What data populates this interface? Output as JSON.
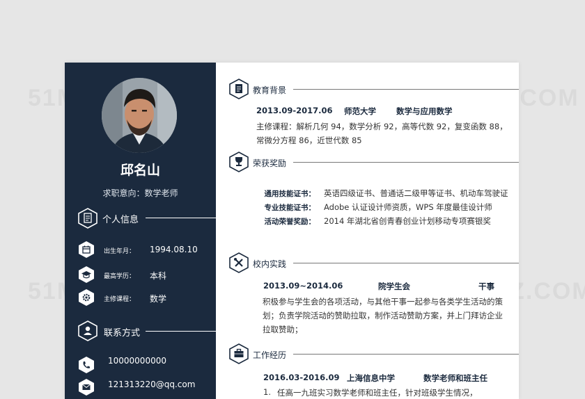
{
  "watermark": "51MZ.COM",
  "sidebar": {
    "name": "邱名山",
    "intent": "求职意向：数学老师",
    "personal": {
      "title": "个人信息",
      "items": [
        {
          "icon": "calendar-icon",
          "label": "出生年月：",
          "value": "1994.08.10"
        },
        {
          "icon": "graduation-cap-icon",
          "label": "最高学历：",
          "value": "本科"
        },
        {
          "icon": "gear-icon",
          "label": "主修课程：",
          "value": "数学"
        }
      ]
    },
    "contact": {
      "title": "联系方式",
      "items": [
        {
          "icon": "phone-icon",
          "value": "10000000000"
        },
        {
          "icon": "envelope-icon",
          "value": "121313220@qq.com"
        }
      ]
    }
  },
  "main": {
    "education": {
      "title": "教育背景",
      "period": "2013.09-2017.06",
      "school": "师范大学",
      "major": "数学与应用数学",
      "lines": [
        "主修课程：解析几何 94，数学分析 92，高等代数 92，复变函数 88，",
        "常微分方程 86，近世代数 85"
      ]
    },
    "awards": {
      "title": "荣获奖励",
      "items": [
        {
          "label": "通用技能证书：",
          "value": "英语四级证书、普通话二级甲等证书、机动车驾驶证"
        },
        {
          "label": "专业技能证书：",
          "value": "Adobe 认证设计师资质，WPS 年度最佳设计师"
        },
        {
          "label": "活动荣誉奖励：",
          "value": "2014 年湖北省创青春创业计划移动专项赛银奖"
        }
      ]
    },
    "campus": {
      "title": "校内实践",
      "period": "2013.09~2014.06",
      "org": "院学生会",
      "role": "干事",
      "lines": [
        "积极参与学生会的各项活动，与其他干事一起参与各类学生活动的策",
        "划；负责学院活动的赞助拉取，制作活动赞助方案，并上门拜访企业",
        "拉取赞助；"
      ]
    },
    "work": {
      "title": "工作经历",
      "period": "2016.03-2016.09",
      "company": "上海信息中学",
      "position": "数学老师和班主任",
      "item_num": "1.",
      "item_text": "任高一九班实习数学老师和班主任，针对班级学生情况，"
    }
  },
  "colors": {
    "navy": "#1b2a3e",
    "paper": "#ffffff",
    "background": "#e6e6e6"
  }
}
